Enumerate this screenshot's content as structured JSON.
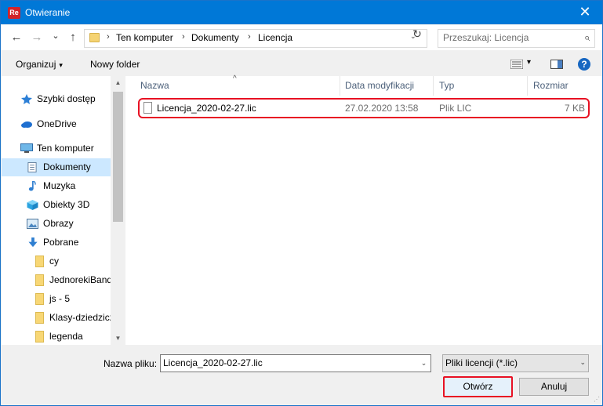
{
  "window": {
    "title": "Otwieranie",
    "app_badge": "Re",
    "close_glyph": "✕"
  },
  "nav": {
    "back_glyph": "←",
    "forward_glyph": "→",
    "history_glyph": "⌄",
    "up_glyph": "↑",
    "breadcrumb": [
      "Ten komputer",
      "Dokumenty",
      "Licencja"
    ],
    "sep_glyph": "›",
    "dropdown_glyph": "⌄",
    "refresh_glyph": "↻",
    "search_placeholder": "Przeszukaj: Licencja"
  },
  "commands": {
    "organize": "Organizuj",
    "organize_arrow": "▾",
    "new_folder": "Nowy folder",
    "view_arrow": "▾",
    "help_glyph": "?"
  },
  "sidebar": {
    "items": [
      {
        "label": "Szybki dostęp",
        "icon": "star-icon"
      },
      {
        "label": "OneDrive",
        "icon": "cloud-icon"
      },
      {
        "label": "Ten komputer",
        "icon": "computer-icon"
      },
      {
        "label": "Dokumenty",
        "icon": "documents-icon",
        "selected": true
      },
      {
        "label": "Muzyka",
        "icon": "music-icon"
      },
      {
        "label": "Obiekty 3D",
        "icon": "cube-icon"
      },
      {
        "label": "Obrazy",
        "icon": "pictures-icon"
      },
      {
        "label": "Pobrane",
        "icon": "download-icon"
      },
      {
        "label": "cy",
        "icon": "folder-icon"
      },
      {
        "label": "JednorekiBandyta",
        "icon": "folder-icon"
      },
      {
        "label": "js - 5",
        "icon": "folder-icon"
      },
      {
        "label": "Klasy-dziedziczenie",
        "icon": "folder-icon"
      },
      {
        "label": "legenda",
        "icon": "folder-icon"
      }
    ],
    "scroll_up": "▲",
    "scroll_down": "▼"
  },
  "file_list": {
    "columns": [
      "Nazwa",
      "Data modyfikacji",
      "Typ",
      "Rozmiar"
    ],
    "sort_glyph": "^",
    "rows": [
      {
        "name": "Licencja_2020-02-27.lic",
        "modified": "27.02.2020 13:58",
        "type": "Plik LIC",
        "size": "7 KB"
      }
    ]
  },
  "footer": {
    "filename_label": "Nazwa pliku:",
    "filename_value": "Licencja_2020-02-27.lic",
    "filter_value": "Pliki licencji (*.lic)",
    "dropdown_glyph": "⌄",
    "open_label": "Otwórz",
    "cancel_label": "Anuluj"
  },
  "colors": {
    "accent": "#0078d7",
    "highlight": "#e81123",
    "selected": "#cce8ff"
  }
}
